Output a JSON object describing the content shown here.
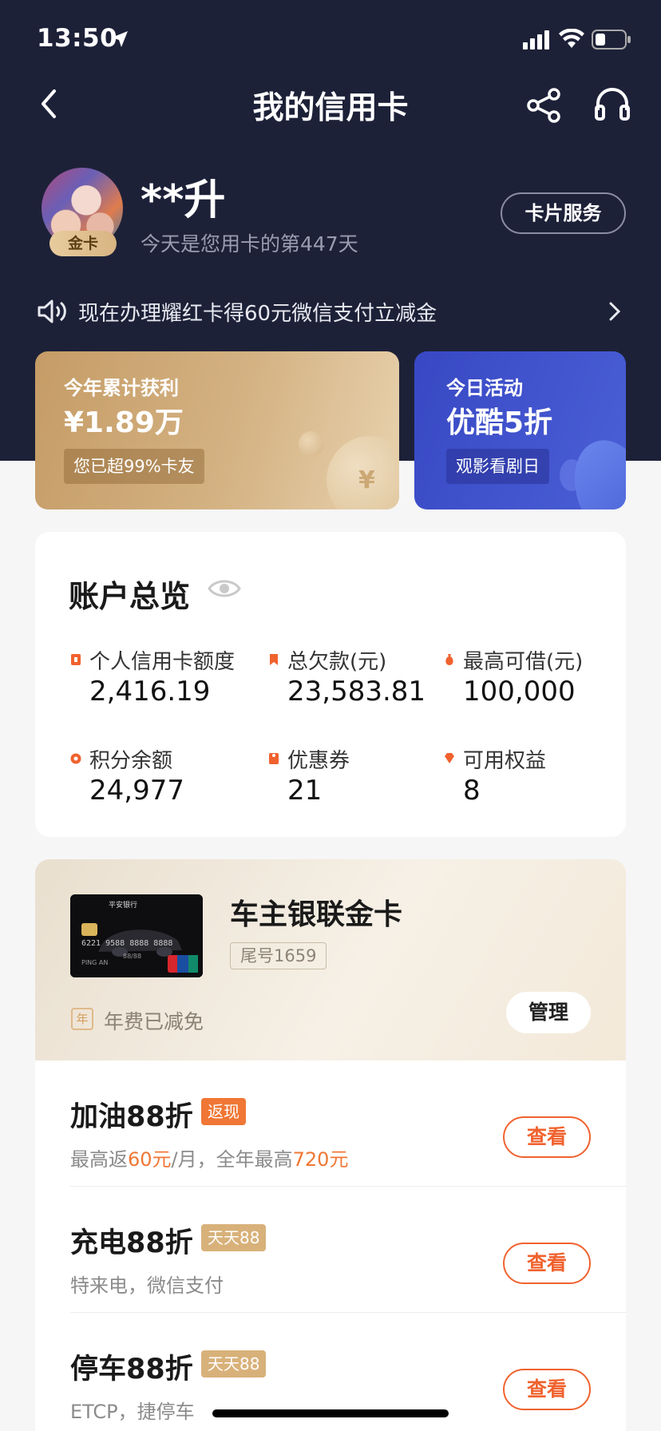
{
  "status_bar": {
    "time": "13:50"
  },
  "nav": {
    "title": "我的信用卡"
  },
  "profile": {
    "name": "**升",
    "tier": "金卡",
    "days_text": "今天是您用卡的第447天",
    "card_service": "卡片服务"
  },
  "announcement": {
    "text": "现在办理耀红卡得60元微信支付立减金"
  },
  "promos": {
    "gold": {
      "label": "今年累计获利",
      "value": "¥1.89万",
      "chip": "您已超99%卡友",
      "coin": "¥"
    },
    "blue": {
      "label": "今日活动",
      "value": "优酷5折",
      "chip": "观影看剧日"
    }
  },
  "overview": {
    "title": "账户总览",
    "stats": [
      {
        "label": "个人信用卡额度",
        "value": "2,416.19"
      },
      {
        "label": "总欠款(元)",
        "value": "23,583.81"
      },
      {
        "label": "最高可借(元)",
        "value": "100,000"
      },
      {
        "label": "积分余额",
        "value": "24,977"
      },
      {
        "label": "优惠券",
        "value": "21"
      },
      {
        "label": "可用权益",
        "value": "8"
      }
    ]
  },
  "card": {
    "name": "车主银联金卡",
    "tail": "尾号1659",
    "fee_icon": "年",
    "fee_text": "年费已减免",
    "manage": "管理",
    "thumb_bank": "平安银行",
    "thumb_number": "6221 9588 8888 8888",
    "thumb_holder": "PING AN",
    "thumb_expiry": "88/88"
  },
  "benefits": [
    {
      "title": "加油88折",
      "tag": "返现",
      "desc_prefix": "最高返",
      "desc_hl1": "60元",
      "desc_mid": "/月，全年最高",
      "desc_hl2": "720元",
      "button": "查看"
    },
    {
      "title": "充电88折",
      "tag": "天天88",
      "desc": "特来电，微信支付",
      "button": "查看"
    },
    {
      "title": "停车88折",
      "tag": "天天88",
      "desc": "ETCP，捷停车",
      "button": "查看"
    }
  ],
  "colors": {
    "header_bg": "#1d2138",
    "accent": "#f0622e",
    "gold": "#d8b17a",
    "blue": "#3848c4"
  }
}
